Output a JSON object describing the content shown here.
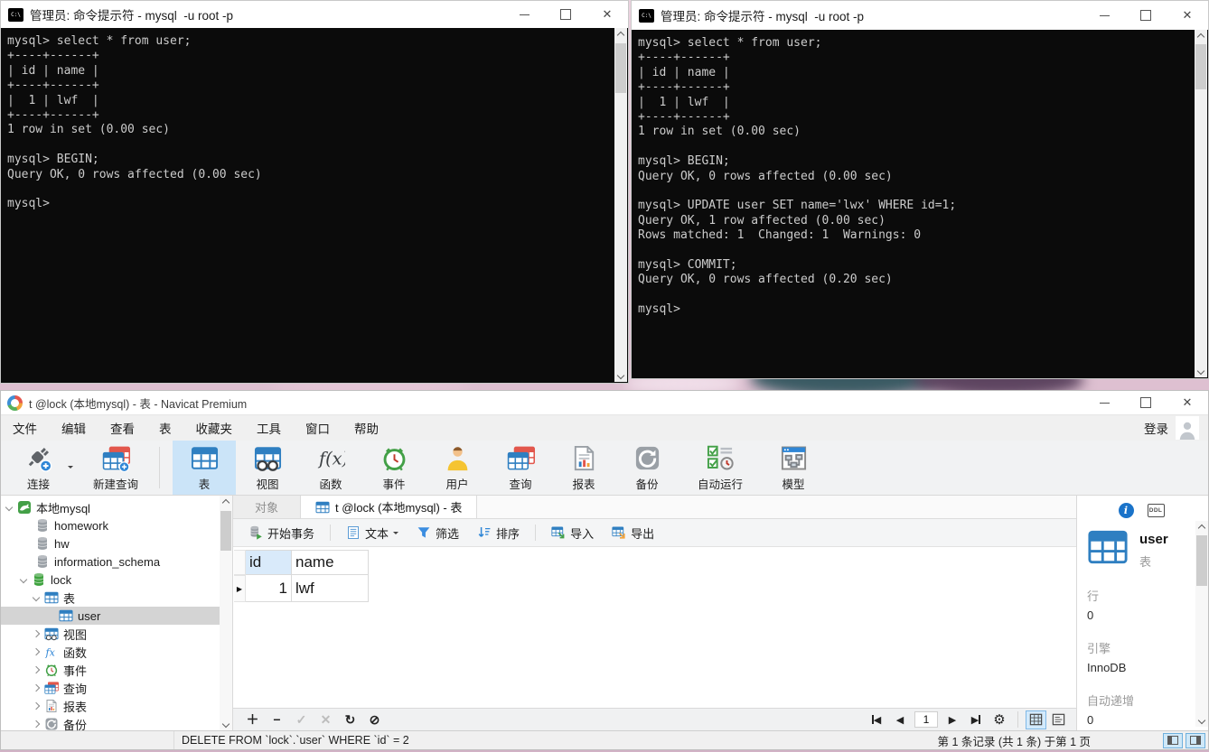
{
  "terminals": {
    "left": {
      "title": "管理员: 命令提示符 - mysql  -u root -p",
      "lines": [
        "mysql> select * from user;",
        "+----+------+",
        "| id | name |",
        "+----+------+",
        "|  1 | lwf  |",
        "+----+------+",
        "1 row in set (0.00 sec)",
        "",
        "mysql> BEGIN;",
        "Query OK, 0 rows affected (0.00 sec)",
        "",
        "mysql>"
      ]
    },
    "right": {
      "title": "管理员: 命令提示符 - mysql  -u root -p",
      "lines": [
        "mysql> select * from user;",
        "+----+------+",
        "| id | name |",
        "+----+------+",
        "|  1 | lwf  |",
        "+----+------+",
        "1 row in set (0.00 sec)",
        "",
        "mysql> BEGIN;",
        "Query OK, 0 rows affected (0.00 sec)",
        "",
        "mysql> UPDATE user SET name='lwx' WHERE id=1;",
        "Query OK, 1 row affected (0.00 sec)",
        "Rows matched: 1  Changed: 1  Warnings: 0",
        "",
        "mysql> COMMIT;",
        "Query OK, 0 rows affected (0.20 sec)",
        "",
        "mysql>"
      ]
    }
  },
  "navicat": {
    "window_title": "t @lock (本地mysql) - 表 - Navicat Premium",
    "menu": {
      "items": [
        "文件",
        "编辑",
        "查看",
        "表",
        "收藏夹",
        "工具",
        "窗口",
        "帮助"
      ],
      "login_label": "登录"
    },
    "toolbar": {
      "labels": [
        "连接",
        "新建查询",
        "表",
        "视图",
        "函数",
        "事件",
        "用户",
        "查询",
        "报表",
        "备份",
        "自动运行",
        "模型"
      ]
    },
    "tree": {
      "items": [
        {
          "label": "本地mysql"
        },
        {
          "label": "homework"
        },
        {
          "label": "hw"
        },
        {
          "label": "information_schema"
        },
        {
          "label": "lock"
        },
        {
          "label": "表"
        },
        {
          "label": "user"
        },
        {
          "label": "视图"
        },
        {
          "label": "函数"
        },
        {
          "label": "事件"
        },
        {
          "label": "查询"
        },
        {
          "label": "报表"
        },
        {
          "label": "备份"
        }
      ]
    },
    "tabs": {
      "objects": "对象",
      "table_tab": "t @lock (本地mysql) - 表"
    },
    "grid_toolbar": {
      "begin_transaction": "开始事务",
      "text": "文本",
      "filter": "筛选",
      "sort": "排序",
      "import": "导入",
      "export": "导出"
    },
    "grid": {
      "columns": [
        "id",
        "name"
      ],
      "rows": [
        {
          "id": "1",
          "name": "lwf"
        }
      ]
    },
    "pagination": {
      "page": "1"
    },
    "info_panel": {
      "ddl_label": "DDL",
      "object_name": "user",
      "object_type": "表",
      "rows_label": "行",
      "rows_value": "0",
      "engine_label": "引擎",
      "engine_value": "InnoDB",
      "auto_increment_label": "自动递增",
      "auto_increment_value": "0"
    },
    "status": {
      "sql": "DELETE FROM `lock`.`user` WHERE `id` = 2",
      "record_info": "第 1 条记录 (共 1 条) 于第 1 页"
    }
  },
  "colors": {
    "accent_blue": "#2f7fc1",
    "toolbar_selected": "#cbe4f8",
    "terminal_bg": "#0b0b0b",
    "terminal_fg": "#cccccc",
    "tree_selected": "#d4d4d4"
  }
}
